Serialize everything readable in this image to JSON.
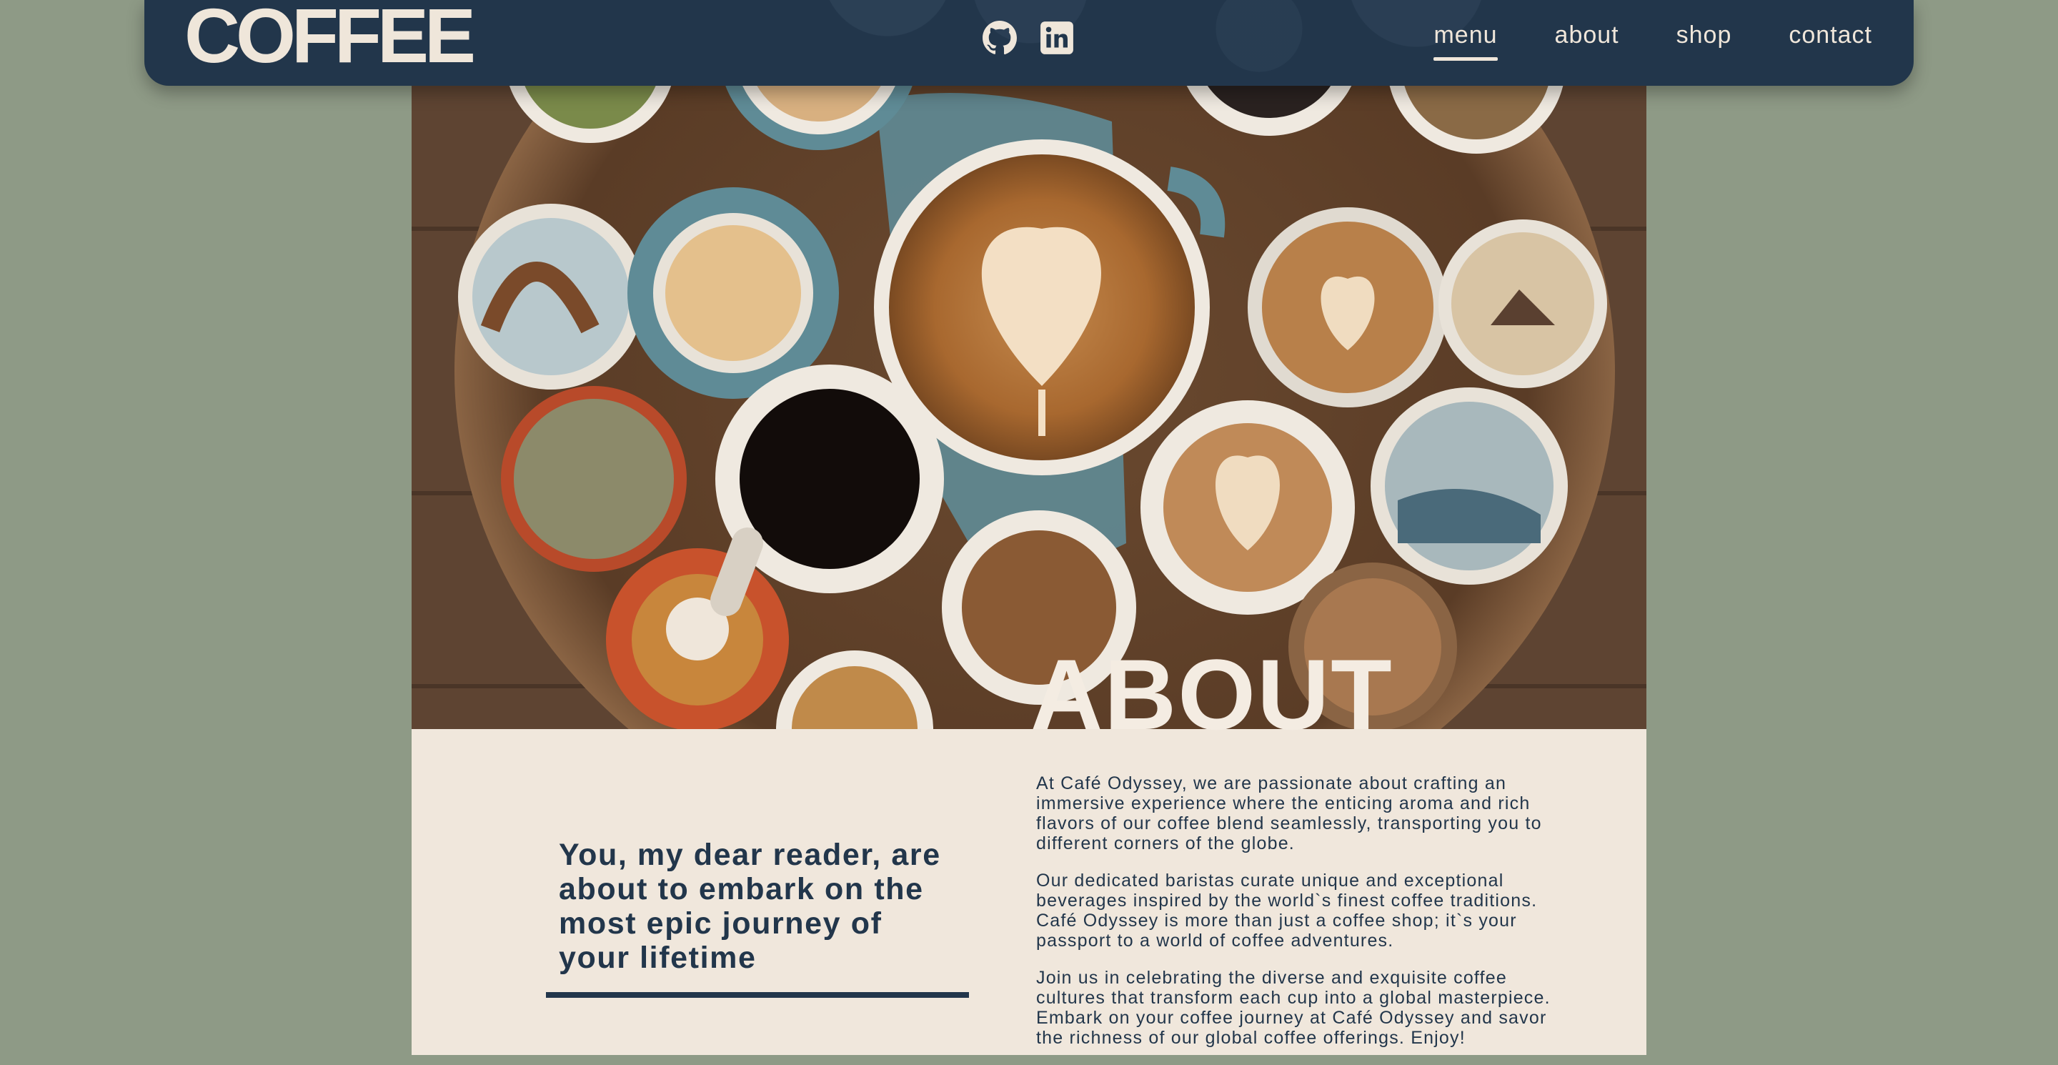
{
  "header": {
    "brand": "COFFEE",
    "socials": [
      {
        "icon": "github-icon"
      },
      {
        "icon": "linkedin-icon"
      }
    ],
    "nav": [
      {
        "label": "menu",
        "active": true
      },
      {
        "label": "about",
        "active": false
      },
      {
        "label": "shop",
        "active": false
      },
      {
        "label": "contact",
        "active": false
      }
    ]
  },
  "hero": {
    "image": "coffee-cups-on-tray"
  },
  "about": {
    "title": "ABOUT",
    "tagline": "You, my dear reader, are about to embark on the most epic journey of your lifetime",
    "paragraphs": [
      "At Café Odyssey, we are passionate about crafting an immersive experience where the enticing aroma and rich flavors of our coffee blend seamlessly, transporting you to different corners of the globe.",
      "Our dedicated baristas curate unique and exceptional beverages inspired by the world`s finest coffee traditions. Café Odyssey is more than just a coffee shop; it`s your passport to a world of coffee adventures.",
      "Join us in celebrating the diverse and exquisite coffee cultures that transform each cup into a global masterpiece. Embark on your coffee journey at Café Odyssey and savor the richness of our global coffee offerings. Enjoy!"
    ]
  },
  "colors": {
    "page_background": "#8e9a86",
    "header_background": "#22364b",
    "cream": "#f0e7dc",
    "navy_text": "#22364b"
  }
}
